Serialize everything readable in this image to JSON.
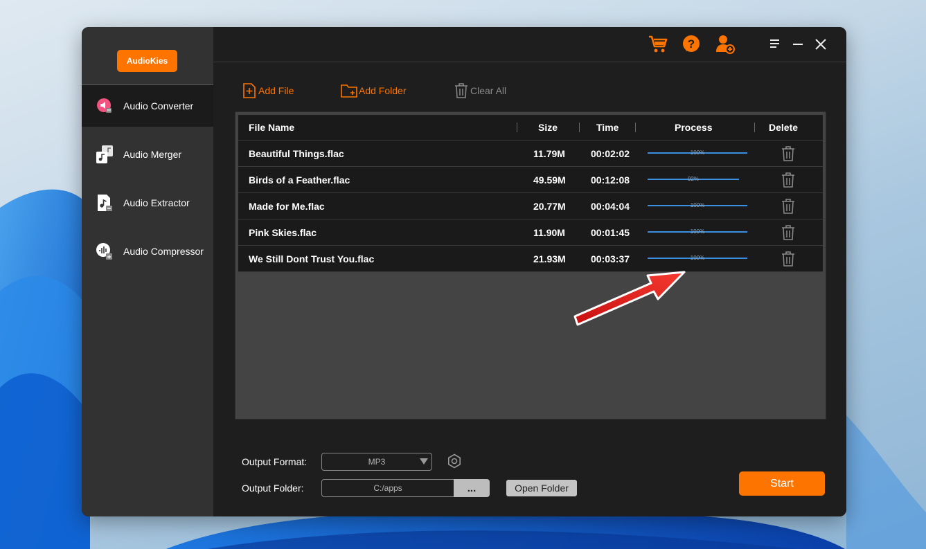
{
  "app": {
    "logo": "AudioKies"
  },
  "sidebar": {
    "items": [
      {
        "label": "Audio Converter",
        "icon": "audio-converter-icon",
        "active": true
      },
      {
        "label": "Audio Merger",
        "icon": "audio-merger-icon",
        "active": false
      },
      {
        "label": "Audio Extractor",
        "icon": "audio-extractor-icon",
        "active": false
      },
      {
        "label": "Audio Compressor",
        "icon": "audio-compressor-icon",
        "active": false
      }
    ]
  },
  "topbar": {
    "icons": [
      "cart-icon",
      "help-icon",
      "user-add-icon",
      "menu-icon",
      "minimize-icon",
      "close-icon"
    ]
  },
  "toolbar": {
    "add_file": "Add File",
    "add_folder": "Add Folder",
    "clear_all": "Clear All"
  },
  "table": {
    "headers": {
      "file_name": "File Name",
      "size": "Size",
      "time": "Time",
      "process": "Process",
      "delete": "Delete"
    },
    "rows": [
      {
        "file_name": "Beautiful Things.flac",
        "size": "11.79M",
        "time": "00:02:02",
        "progress": 100,
        "progress_text": "100%"
      },
      {
        "file_name": "Birds of a Feather.flac",
        "size": "49.59M",
        "time": "00:12:08",
        "progress": 92,
        "progress_text": "92%"
      },
      {
        "file_name": "Made for Me.flac",
        "size": "20.77M",
        "time": "00:04:04",
        "progress": 100,
        "progress_text": "100%"
      },
      {
        "file_name": "Pink Skies.flac",
        "size": "11.90M",
        "time": "00:01:45",
        "progress": 100,
        "progress_text": "100%"
      },
      {
        "file_name": "We Still Dont Trust You.flac",
        "size": "21.93M",
        "time": "00:03:37",
        "progress": 100,
        "progress_text": "100%"
      }
    ]
  },
  "output": {
    "format_label": "Output Format:",
    "format_value": "MP3",
    "folder_label": "Output Folder:",
    "folder_value": "C:/apps",
    "browse_label": "...",
    "open_folder": "Open Folder",
    "start": "Start"
  },
  "colors": {
    "accent": "#fe7400",
    "progress": "#3b8fe0",
    "annotation_arrow": "#e8231f"
  }
}
